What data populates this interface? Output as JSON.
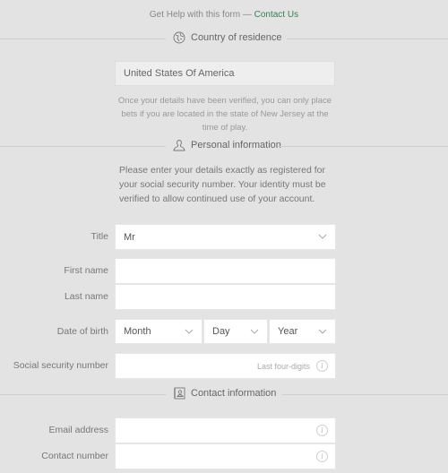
{
  "help": {
    "prefix": "Get Help with this form — ",
    "link": "Contact Us"
  },
  "colors": {
    "link": "#3a7d5c",
    "background": "#e3e3e3"
  },
  "sections": {
    "country": {
      "title": "Country of residence",
      "icon": "globe-icon"
    },
    "personal": {
      "title": "Personal information",
      "icon": "person-icon"
    },
    "contact": {
      "title": "Contact information",
      "icon": "address-book-icon"
    }
  },
  "country": {
    "value": "United States Of America",
    "note": "Once your details have been verified, you can only place bets if you are located in the state of New Jersey at the time of play."
  },
  "personal": {
    "note": "Please enter your details exactly as registered for your social security number. Your identity must be verified to allow continued use of your account.",
    "title_label": "Title",
    "title_value": "Mr",
    "first_name_label": "First name",
    "first_name_value": "",
    "last_name_label": "Last name",
    "last_name_value": "",
    "dob_label": "Date of birth",
    "dob_month": "Month",
    "dob_day": "Day",
    "dob_year": "Year",
    "ssn_label": "Social security number",
    "ssn_hint": "Last four-digits",
    "info_glyph": "i"
  },
  "contact": {
    "email_label": "Email address",
    "email_value": "",
    "phone_label": "Contact number",
    "phone_value": ""
  }
}
